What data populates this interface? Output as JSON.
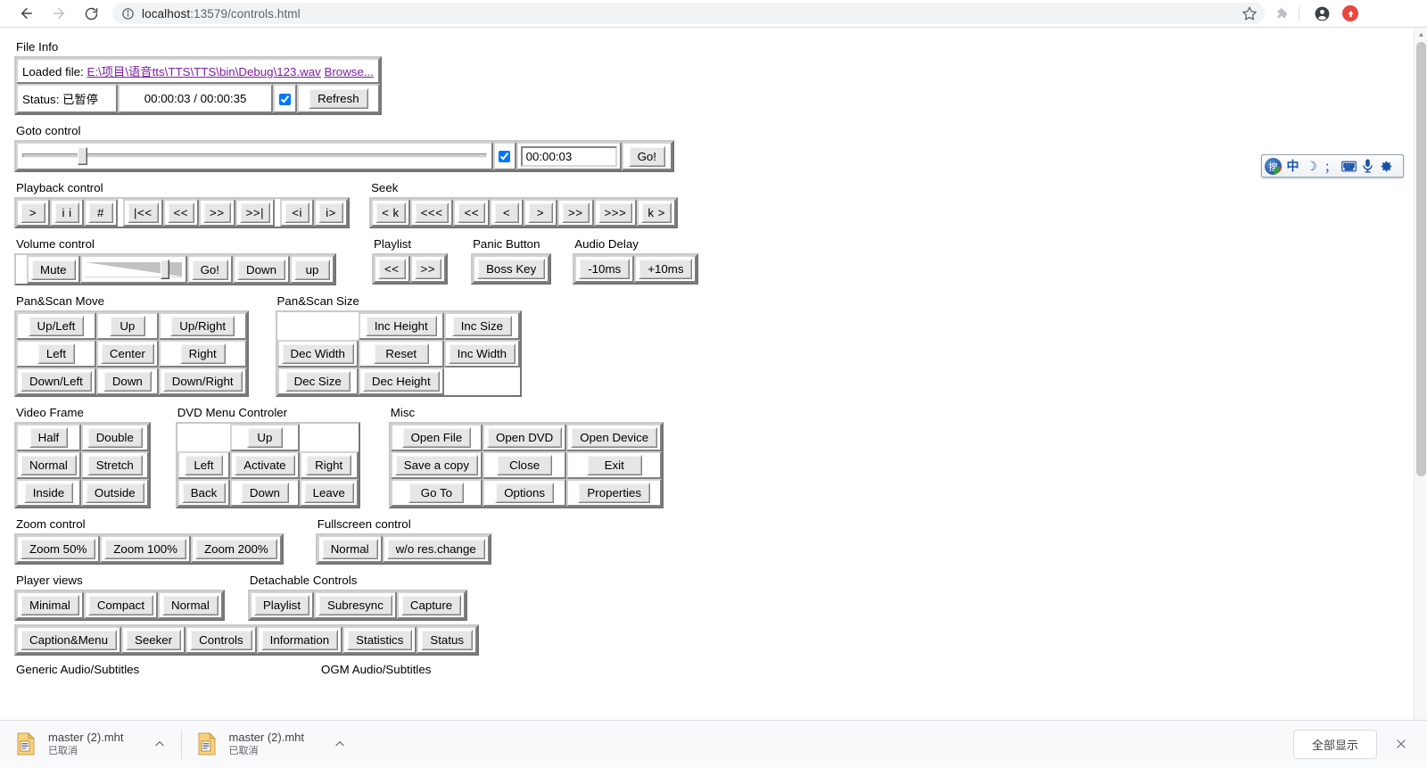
{
  "browser": {
    "back_icon": "back-arrow-icon",
    "forward_icon": "forward-arrow-icon",
    "reload_icon": "reload-icon",
    "site_info_icon": "info-circle-icon",
    "url_scheme_host": "localhost",
    "url_rest": ":13579/controls.html",
    "star_icon": "star-icon",
    "extension_icon": "puzzle-extension-icon",
    "profile_icon": "profile-avatar-icon",
    "update_icon": "update-available-icon"
  },
  "page": {
    "file_info": {
      "label": "File Info",
      "loaded_file_label": "Loaded file:",
      "loaded_file_path": "E:\\项目\\语音tts\\TTS\\TTS\\bin\\Debug\\123.wav",
      "browse_label": "Browse...",
      "status_label": "Status: 已暂停",
      "time": "00:00:03 / 00:00:35",
      "autorefresh_checked": true,
      "refresh_label": "Refresh"
    },
    "goto": {
      "label": "Goto control",
      "slider_value_pct": 12,
      "check_checked": true,
      "time_value": "00:00:03",
      "go_label": "Go!"
    },
    "playback": {
      "label": "Playback control",
      "groups": [
        [
          ">",
          "i i",
          "#"
        ],
        [
          "|<<",
          "<<",
          ">>",
          ">>|"
        ],
        [
          "<i",
          "i>"
        ]
      ]
    },
    "seek": {
      "label": "Seek",
      "buttons": [
        "< k",
        "<<<",
        "<<",
        "<",
        ">",
        ">>",
        ">>>",
        "k >"
      ]
    },
    "volume": {
      "label": "Volume control",
      "mute_label": "Mute",
      "slider_value_pct": 78,
      "go_label": "Go!",
      "down_label": "Down",
      "up_label": "up"
    },
    "playlist": {
      "label": "Playlist",
      "prev_label": "<<",
      "next_label": ">>"
    },
    "panic": {
      "label": "Panic Button",
      "boss_key_label": "Boss Key"
    },
    "audio_delay": {
      "label": "Audio Delay",
      "minus_label": "-10ms",
      "plus_label": "+10ms"
    },
    "panscan_move": {
      "label": "Pan&Scan Move",
      "rows": [
        [
          "Up/Left",
          "Up",
          "Up/Right"
        ],
        [
          "Left",
          "Center",
          "Right"
        ],
        [
          "Down/Left",
          "Down",
          "Down/Right"
        ]
      ]
    },
    "panscan_size": {
      "label": "Pan&Scan Size",
      "rows": [
        [
          "",
          "Inc Height",
          "Inc Size"
        ],
        [
          "Dec Width",
          "Reset",
          "Inc Width"
        ],
        [
          "Dec Size",
          "Dec Height",
          ""
        ]
      ]
    },
    "video_frame": {
      "label": "Video Frame",
      "rows": [
        [
          "Half",
          "Double"
        ],
        [
          "Normal",
          "Stretch"
        ],
        [
          "Inside",
          "Outside"
        ]
      ]
    },
    "dvd_menu": {
      "label": "DVD Menu Controler",
      "rows": [
        [
          "",
          "Up",
          ""
        ],
        [
          "Left",
          "Activate",
          "Right"
        ],
        [
          "Back",
          "Down",
          "Leave"
        ]
      ]
    },
    "misc": {
      "label": "Misc",
      "rows": [
        [
          "Open File",
          "Open DVD",
          "Open Device"
        ],
        [
          "Save a copy",
          "Close",
          "Exit"
        ],
        [
          "Go To",
          "Options",
          "Properties"
        ]
      ]
    },
    "zoom_control": {
      "label": "Zoom control",
      "buttons": [
        "Zoom 50%",
        "Zoom 100%",
        "Zoom 200%"
      ]
    },
    "fullscreen_control": {
      "label": "Fullscreen control",
      "buttons": [
        "Normal",
        "w/o res.change"
      ]
    },
    "player_views": {
      "label": "Player views",
      "buttons": [
        "Minimal",
        "Compact",
        "Normal"
      ]
    },
    "detachable_controls": {
      "label": "Detachable Controls",
      "buttons": [
        "Playlist",
        "Subresync",
        "Capture"
      ]
    },
    "detachable_row2": {
      "buttons": [
        "Caption&Menu",
        "Seeker",
        "Controls",
        "Information",
        "Statistics",
        "Status"
      ]
    },
    "cut_labels": {
      "generic": "Generic Audio/Subtitles",
      "ogm": "OGM Audio/Subtitles"
    }
  },
  "ime": {
    "logo_label": "搜",
    "mode_label": "中",
    "moon_label": "☽",
    "punct_label": "；",
    "keyboard_icon": "keyboard-icon",
    "mic_icon": "microphone-icon",
    "gear_icon": "gear-icon"
  },
  "downloads": {
    "items": [
      {
        "name": "master (2).mht",
        "status": "已取消"
      },
      {
        "name": "master (2).mht",
        "status": "已取消"
      }
    ],
    "show_all_label": "全部显示",
    "close_icon": "close-icon"
  },
  "colors": {
    "link": "#7c1ea1",
    "accent_red": "#e8453c",
    "ime_blue": "#1852a8",
    "button_face": "#e6e6e6"
  }
}
